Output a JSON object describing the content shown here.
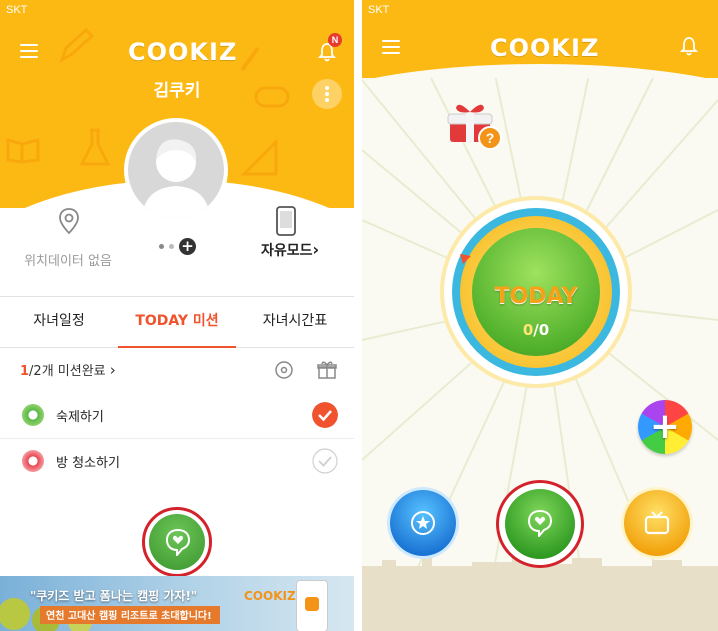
{
  "left": {
    "status": {
      "carrier": "SKT"
    },
    "header": {
      "logo": "COOKIZ",
      "notification_badge": "N",
      "child_name": "김쿠키"
    },
    "profile": {
      "location_label": "위치데이터 없음",
      "free_mode_label": "자유모드",
      "free_mode_chevron": "›"
    },
    "tabs": [
      {
        "label": "자녀일정",
        "active": false
      },
      {
        "label": "TODAY 미션",
        "active": true
      },
      {
        "label": "자녀시간표",
        "active": false
      }
    ],
    "missions_summary": {
      "done": "1",
      "rest": "/2개 미션완료",
      "chevron": "›"
    },
    "missions": [
      {
        "label": "숙제하기",
        "done": true
      },
      {
        "label": "방 청소하기",
        "done": false
      }
    ],
    "banner": {
      "line1": "\"쿠키즈 받고 폼나는 캠핑 가자!\"",
      "line2": "연천 고대산 캠핑 리조트로 초대합니다!",
      "logo": "COOKIZ"
    },
    "colors": {
      "header": "#fdb913",
      "accent": "#f0532d",
      "chat_green": "#4aa63d",
      "highlight_ring": "#d3222a"
    }
  },
  "right": {
    "status": {
      "carrier": "SKT"
    },
    "header": {
      "logo": "COOKIZ"
    },
    "today": {
      "label": "TODAY",
      "done": "0",
      "separator": "/",
      "total": "0"
    },
    "icons": [
      "gift-question-icon",
      "add-rainbow-icon",
      "star-icon",
      "chat-icon",
      "tv-icon"
    ]
  }
}
